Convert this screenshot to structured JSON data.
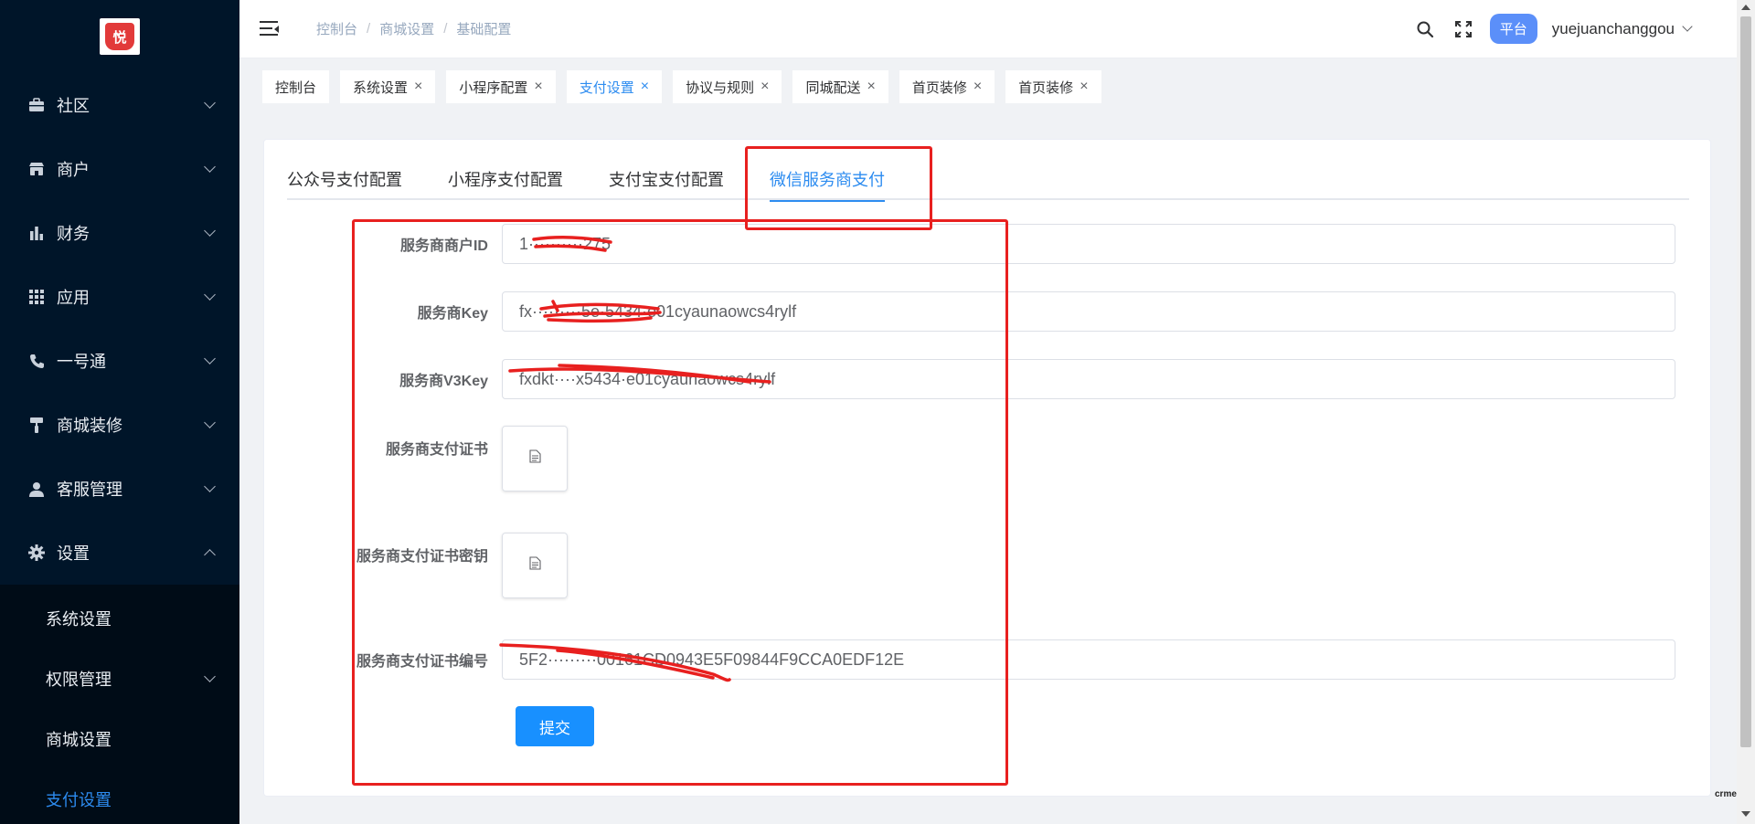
{
  "colors": {
    "sidebar_bg": "#001529",
    "accent": "#2d8cf0",
    "submit": "#1890ff",
    "annotation": "#e8201f",
    "platform_badge": "#5b8ff9"
  },
  "logo": {
    "text": "悦"
  },
  "sidebar": {
    "items": [
      {
        "label": "社区",
        "icon": "briefcase-icon"
      },
      {
        "label": "商户",
        "icon": "store-icon"
      },
      {
        "label": "财务",
        "icon": "bar-chart-icon"
      },
      {
        "label": "应用",
        "icon": "grid-icon"
      },
      {
        "label": "一号通",
        "icon": "phone-icon"
      },
      {
        "label": "商城装修",
        "icon": "paint-roller-icon"
      },
      {
        "label": "客服管理",
        "icon": "user-icon"
      },
      {
        "label": "设置",
        "icon": "gear-icon",
        "expanded": true
      }
    ],
    "sub_items": [
      {
        "label": "系统设置"
      },
      {
        "label": "权限管理",
        "has_children": true
      },
      {
        "label": "商城设置"
      },
      {
        "label": "支付设置",
        "active": true
      }
    ]
  },
  "header": {
    "breadcrumb": [
      "控制台",
      "商城设置",
      "基础配置"
    ],
    "breadcrumb_sep": "/",
    "platform_label": "平台",
    "username": "yuejuanchanggou"
  },
  "tags": [
    {
      "label": "控制台",
      "closable": false
    },
    {
      "label": "系统设置",
      "closable": true
    },
    {
      "label": "小程序配置",
      "closable": true
    },
    {
      "label": "支付设置",
      "closable": true,
      "active": true
    },
    {
      "label": "协议与规则",
      "closable": true
    },
    {
      "label": "同城配送",
      "closable": true
    },
    {
      "label": "首页装修",
      "closable": true
    },
    {
      "label": "首页装修",
      "closable": true
    }
  ],
  "tag_close_symbol": "×",
  "tabs": [
    {
      "label": "公众号支付配置"
    },
    {
      "label": "小程序支付配置"
    },
    {
      "label": "支付宝支付配置"
    },
    {
      "label": "微信服务商支付",
      "active": true
    }
  ],
  "form": {
    "merchant_id": {
      "label": "服务商商户ID",
      "value": "1··········275"
    },
    "key": {
      "label": "服务商Key",
      "value": "fx·········5e·5434·e01cyaunaowcs4rylf"
    },
    "v3key": {
      "label": "服务商V3Key",
      "value": "fxdkt····x5434·e01cyaunaowcs4rylf"
    },
    "cert": {
      "label": "服务商支付证书",
      "icon": "document-icon"
    },
    "cert_key": {
      "label": "服务商支付证书密钥",
      "icon": "document-icon"
    },
    "cert_serial": {
      "label": "服务商支付证书编号",
      "value": "5F2·········00161CD0943E5F09844F9CCA0EDF12E"
    },
    "submit_label": "提交"
  },
  "watermark": "crmeb"
}
